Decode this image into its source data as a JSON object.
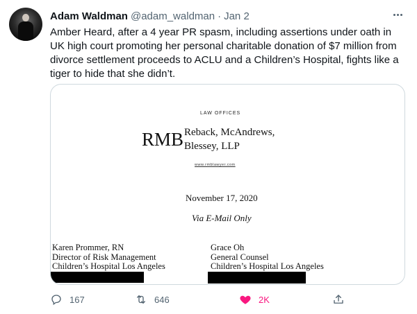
{
  "author": {
    "display_name": "Adam Waldman",
    "handle": "@adam_waldman",
    "separator": "·",
    "date": "Jan 2"
  },
  "tweet": {
    "text": "Amber Heard, after a 4 year PR spasm, including assertions under oath in UK high court promoting her personal charitable donation of $7 million from divorce settlement proceeds to ACLU and a Children’s Hospital, fights like a tiger to hide that she didn’t."
  },
  "document": {
    "law_offices": "LAW OFFICES",
    "logo": "RMB",
    "firm_line1": "Reback, McAndrews,",
    "firm_line2": "Blessey, LLP",
    "url": "www.rmblawyer.com",
    "date": "November 17, 2020",
    "via": "Via E-Mail Only",
    "left_recipient": {
      "line1": "Karen Prommer, RN",
      "line2": "Director of Risk Management",
      "line3": "Children’s Hospital Los Angeles"
    },
    "right_recipient": {
      "line1": "Grace Oh",
      "line2": "General Counsel",
      "line3": "Children’s Hospital Los Angeles"
    }
  },
  "actions": {
    "reply_count": "167",
    "retweet_count": "646",
    "like_count": "2K",
    "like_color": "#f91880"
  },
  "icons": [
    "more-icon",
    "reply-icon",
    "retweet-icon",
    "heart-icon",
    "share-icon"
  ]
}
